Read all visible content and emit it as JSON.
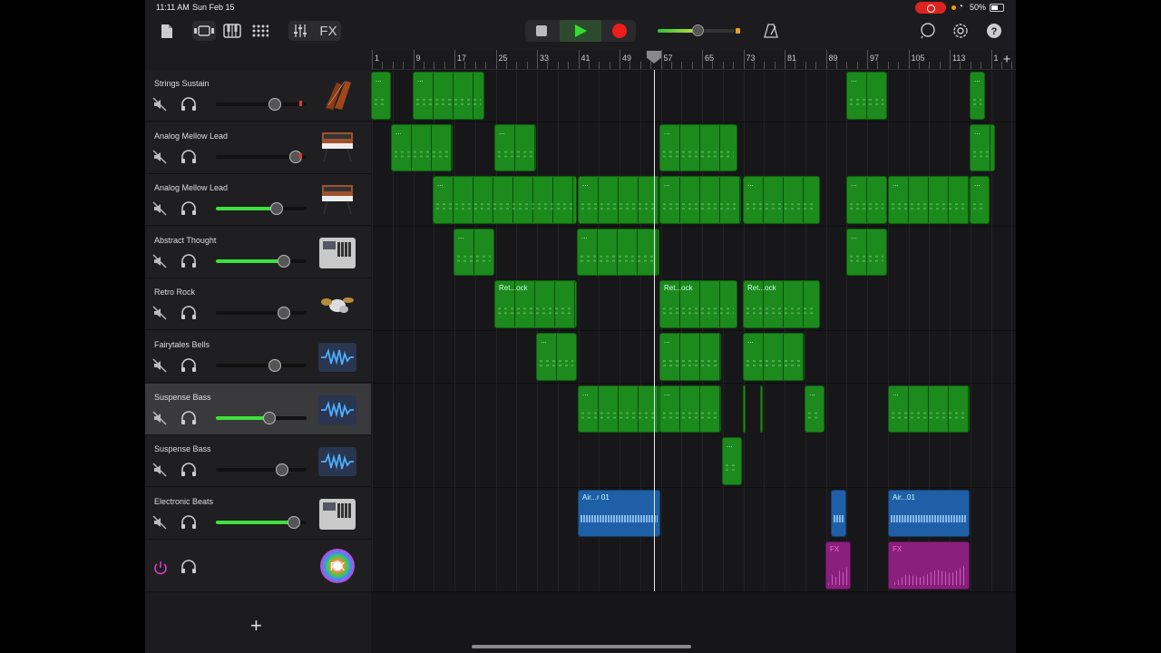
{
  "status_bar": {
    "time": "11:11 AM",
    "date": "Sun Feb 15",
    "battery": "50%"
  },
  "toolbar": {
    "fx_label": "FX",
    "icons": [
      "document-icon",
      "view-toggle-icon",
      "keyboard-icon",
      "grid-icon",
      "mixer-icon",
      "stop-icon",
      "play-icon",
      "record-icon",
      "metronome-icon",
      "loop-icon",
      "settings-icon",
      "help-icon"
    ],
    "master_volume_fraction": 0.52,
    "play_color": "#2ee02e",
    "record_color": "#ee1c1c"
  },
  "ruler": {
    "bars": [
      "1",
      "9",
      "17",
      "25",
      "33",
      "41",
      "49",
      "57",
      "65",
      "73",
      "81",
      "89",
      "97",
      "105",
      "113",
      "1"
    ]
  },
  "tracks": [
    {
      "name": "Strings Sustain",
      "instrument": "strings-icon",
      "volume": 0.7,
      "has_meter": true
    },
    {
      "name": "Analog Mellow Lead",
      "instrument": "synth-icon",
      "volume": 0.95,
      "has_meter": true
    },
    {
      "name": "Analog Mellow Lead",
      "instrument": "synth-icon",
      "volume": 0.72
    },
    {
      "name": "Abstract Thought",
      "instrument": "drum-machine-icon",
      "volume": 0.8
    },
    {
      "name": "Retro Rock",
      "instrument": "drum-kit-icon",
      "volume": 0.8
    },
    {
      "name": "Fairytales Bells",
      "instrument": "waveform-icon",
      "volume": 0.7
    },
    {
      "name": "Suspense Bass",
      "instrument": "waveform-icon",
      "volume": 0.63,
      "selected": true
    },
    {
      "name": "Suspense Bass",
      "instrument": "waveform-icon",
      "volume": 0.78
    },
    {
      "name": "Electronic Beats",
      "instrument": "drum-machine-icon",
      "volume": 0.92
    }
  ],
  "fx_track": {
    "label": "FX"
  },
  "regions": {
    "retro_rock_label": "Ret...ock",
    "electronic_beats_label": "Air...r 01",
    "electronic_beats_label_2": "Air...01",
    "fx_label": "FX",
    "ellipsis": "..."
  },
  "colors": {
    "midi_region": "#1c8a1c",
    "audio_region": "#1f5fa8",
    "fx_region": "#8a1f7e"
  }
}
